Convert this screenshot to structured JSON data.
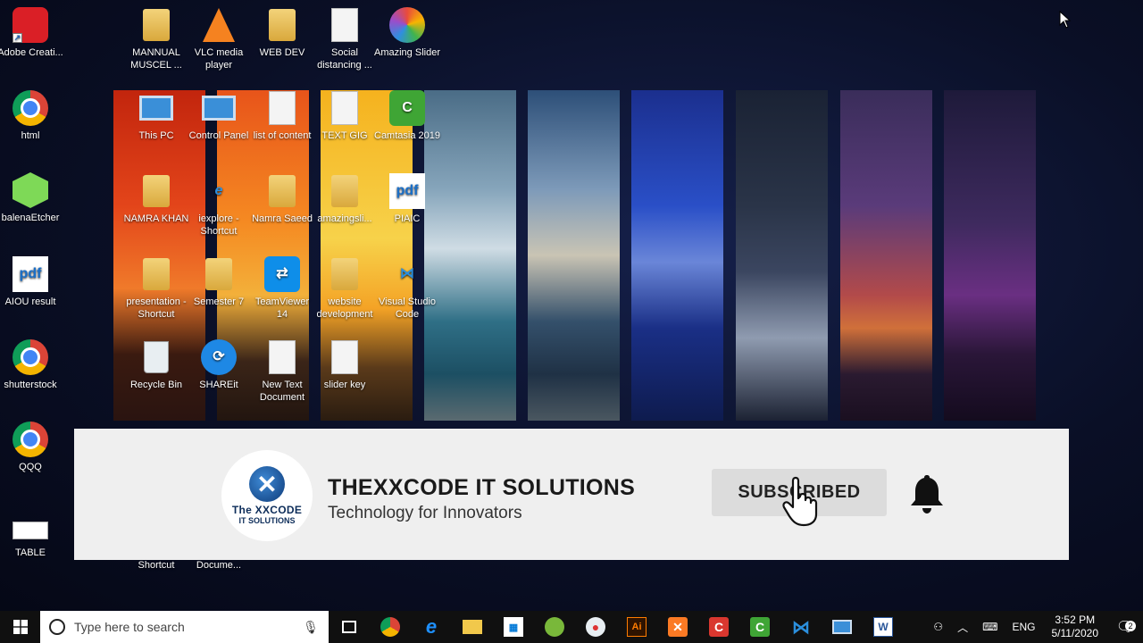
{
  "desktop": {
    "icons": [
      {
        "label": "Adobe Creati...",
        "icon": "adobe-cc-icon"
      },
      {
        "label": "html",
        "icon": "chrome-icon"
      },
      {
        "label": "balenaEtcher",
        "icon": "balena-etcher-icon"
      },
      {
        "label": "AIOU result",
        "icon": "pdf-icon"
      },
      {
        "label": "shutterstock",
        "icon": "chrome-icon"
      },
      {
        "label": "QQQ",
        "icon": "chrome-icon"
      },
      {
        "label": "TABLE",
        "icon": "table-icon"
      },
      {
        "label": "MANNUAL MUSCEL ...",
        "icon": "folder-icon"
      },
      {
        "label": "VLC media player",
        "icon": "vlc-icon"
      },
      {
        "label": "WEB DEV",
        "icon": "folder-icon"
      },
      {
        "label": "Social distancing ...",
        "icon": "word-doc-icon"
      },
      {
        "label": "Amazing Slider",
        "icon": "amazing-slider-icon"
      },
      {
        "label": "This PC",
        "icon": "this-pc-icon"
      },
      {
        "label": "Control Panel",
        "icon": "control-panel-icon"
      },
      {
        "label": "list of content",
        "icon": "word-doc-icon"
      },
      {
        "label": "TEXT GIG",
        "icon": "text-file-icon"
      },
      {
        "label": "Camtasia 2019",
        "icon": "camtasia-icon"
      },
      {
        "label": "NAMRA KHAN",
        "icon": "user-folder-icon"
      },
      {
        "label": "iexplore - Shortcut",
        "icon": "ie-icon"
      },
      {
        "label": "Namra Saeed",
        "icon": "folder-icon"
      },
      {
        "label": "amazingsli...",
        "icon": "folder-icon"
      },
      {
        "label": "PIAIC",
        "icon": "pdf-icon"
      },
      {
        "label": "presentation - Shortcut",
        "icon": "folder-icon"
      },
      {
        "label": "Semester 7",
        "icon": "folder-icon"
      },
      {
        "label": "TeamViewer 14",
        "icon": "teamviewer-icon"
      },
      {
        "label": "website development",
        "icon": "folder-icon"
      },
      {
        "label": "Visual Studio Code",
        "icon": "vscode-icon"
      },
      {
        "label": "Recycle Bin",
        "icon": "recycle-bin-icon"
      },
      {
        "label": "SHAREit",
        "icon": "shareit-icon"
      },
      {
        "label": "New Text Document",
        "icon": "text-file-icon"
      },
      {
        "label": "slider key",
        "icon": "text-file-icon"
      },
      {
        "label": "Shortcut",
        "icon": ""
      },
      {
        "label": "Docume...",
        "icon": ""
      }
    ]
  },
  "banner": {
    "logo_line1": "The XXCODE",
    "logo_line2": "IT SOLUTIONS",
    "brand_name": "THEXXCODE IT SOLUTIONS",
    "tagline": "Technology for Innovators",
    "subscribe_label": "SUBSCRIBED"
  },
  "taskbar": {
    "search_placeholder": "Type here to search",
    "language": "ENG",
    "time": "3:52 PM",
    "date": "5/11/2020",
    "notification_count": "2",
    "apps": [
      "task-view-icon",
      "chrome-icon",
      "edge-icon",
      "file-explorer-icon",
      "store-icon",
      "android-icon",
      "paint-icon",
      "illustrator-icon",
      "xampp-icon",
      "camtasia-red-icon",
      "camtasia-green-icon",
      "vscode-icon",
      "network-pc-icon",
      "word-icon"
    ]
  },
  "colors": {
    "banner_bg": "#efefef",
    "subscribe_bg": "#dcdcdc",
    "taskbar_bg": "#101010"
  }
}
